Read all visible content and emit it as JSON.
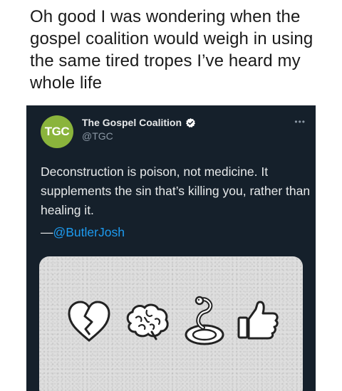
{
  "caption": "Oh good I was wondering when the gospel coalition would weigh in using the same tired tropes I’ve heard my whole life",
  "tweet": {
    "avatar_text": "TGC",
    "display_name": "The Gospel Coalition",
    "handle": "@TGC",
    "more_label": "•••",
    "body": "Deconstruction is poison, not medicine. It supplements the sin that’s killing you, rather than healing it.",
    "attribution_prefix": "—",
    "attribution_handle": "@ButlerJosh"
  },
  "colors": {
    "tweet_bg": "#15202b",
    "avatar_bg": "#8ab43c",
    "link": "#1d9bf0",
    "verified": "#ffffff"
  },
  "media_icons": [
    "broken-heart-icon",
    "brain-icon",
    "snake-icon",
    "thumbs-up-icon"
  ]
}
